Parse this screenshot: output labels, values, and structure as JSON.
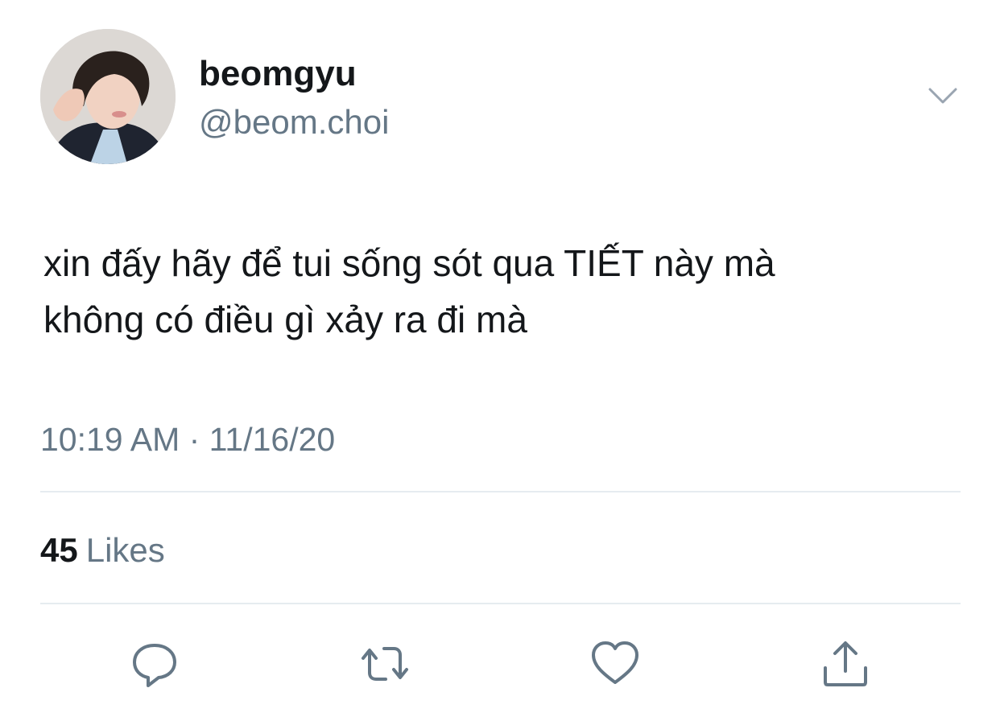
{
  "user": {
    "display_name": "beomgyu",
    "handle": "@beom.choi",
    "avatar": "profile-photo"
  },
  "tweet": {
    "text_lines": [
      "xin đấy hãy để tui sống sót qua TIẾT này mà",
      "không có điều gì xảy ra đi mà"
    ],
    "timestamp": "10:19 AM · 11/16/20"
  },
  "stats": {
    "likes_count": "45",
    "likes_label": "Likes"
  },
  "actions": [
    {
      "name": "reply",
      "icon": "reply-icon"
    },
    {
      "name": "retweet",
      "icon": "retweet-icon"
    },
    {
      "name": "like",
      "icon": "heart-icon"
    },
    {
      "name": "share",
      "icon": "share-icon"
    }
  ],
  "colors": {
    "text": "#14171a",
    "secondary": "#657786",
    "divider": "#e6ecf0",
    "icon": "#657786"
  }
}
